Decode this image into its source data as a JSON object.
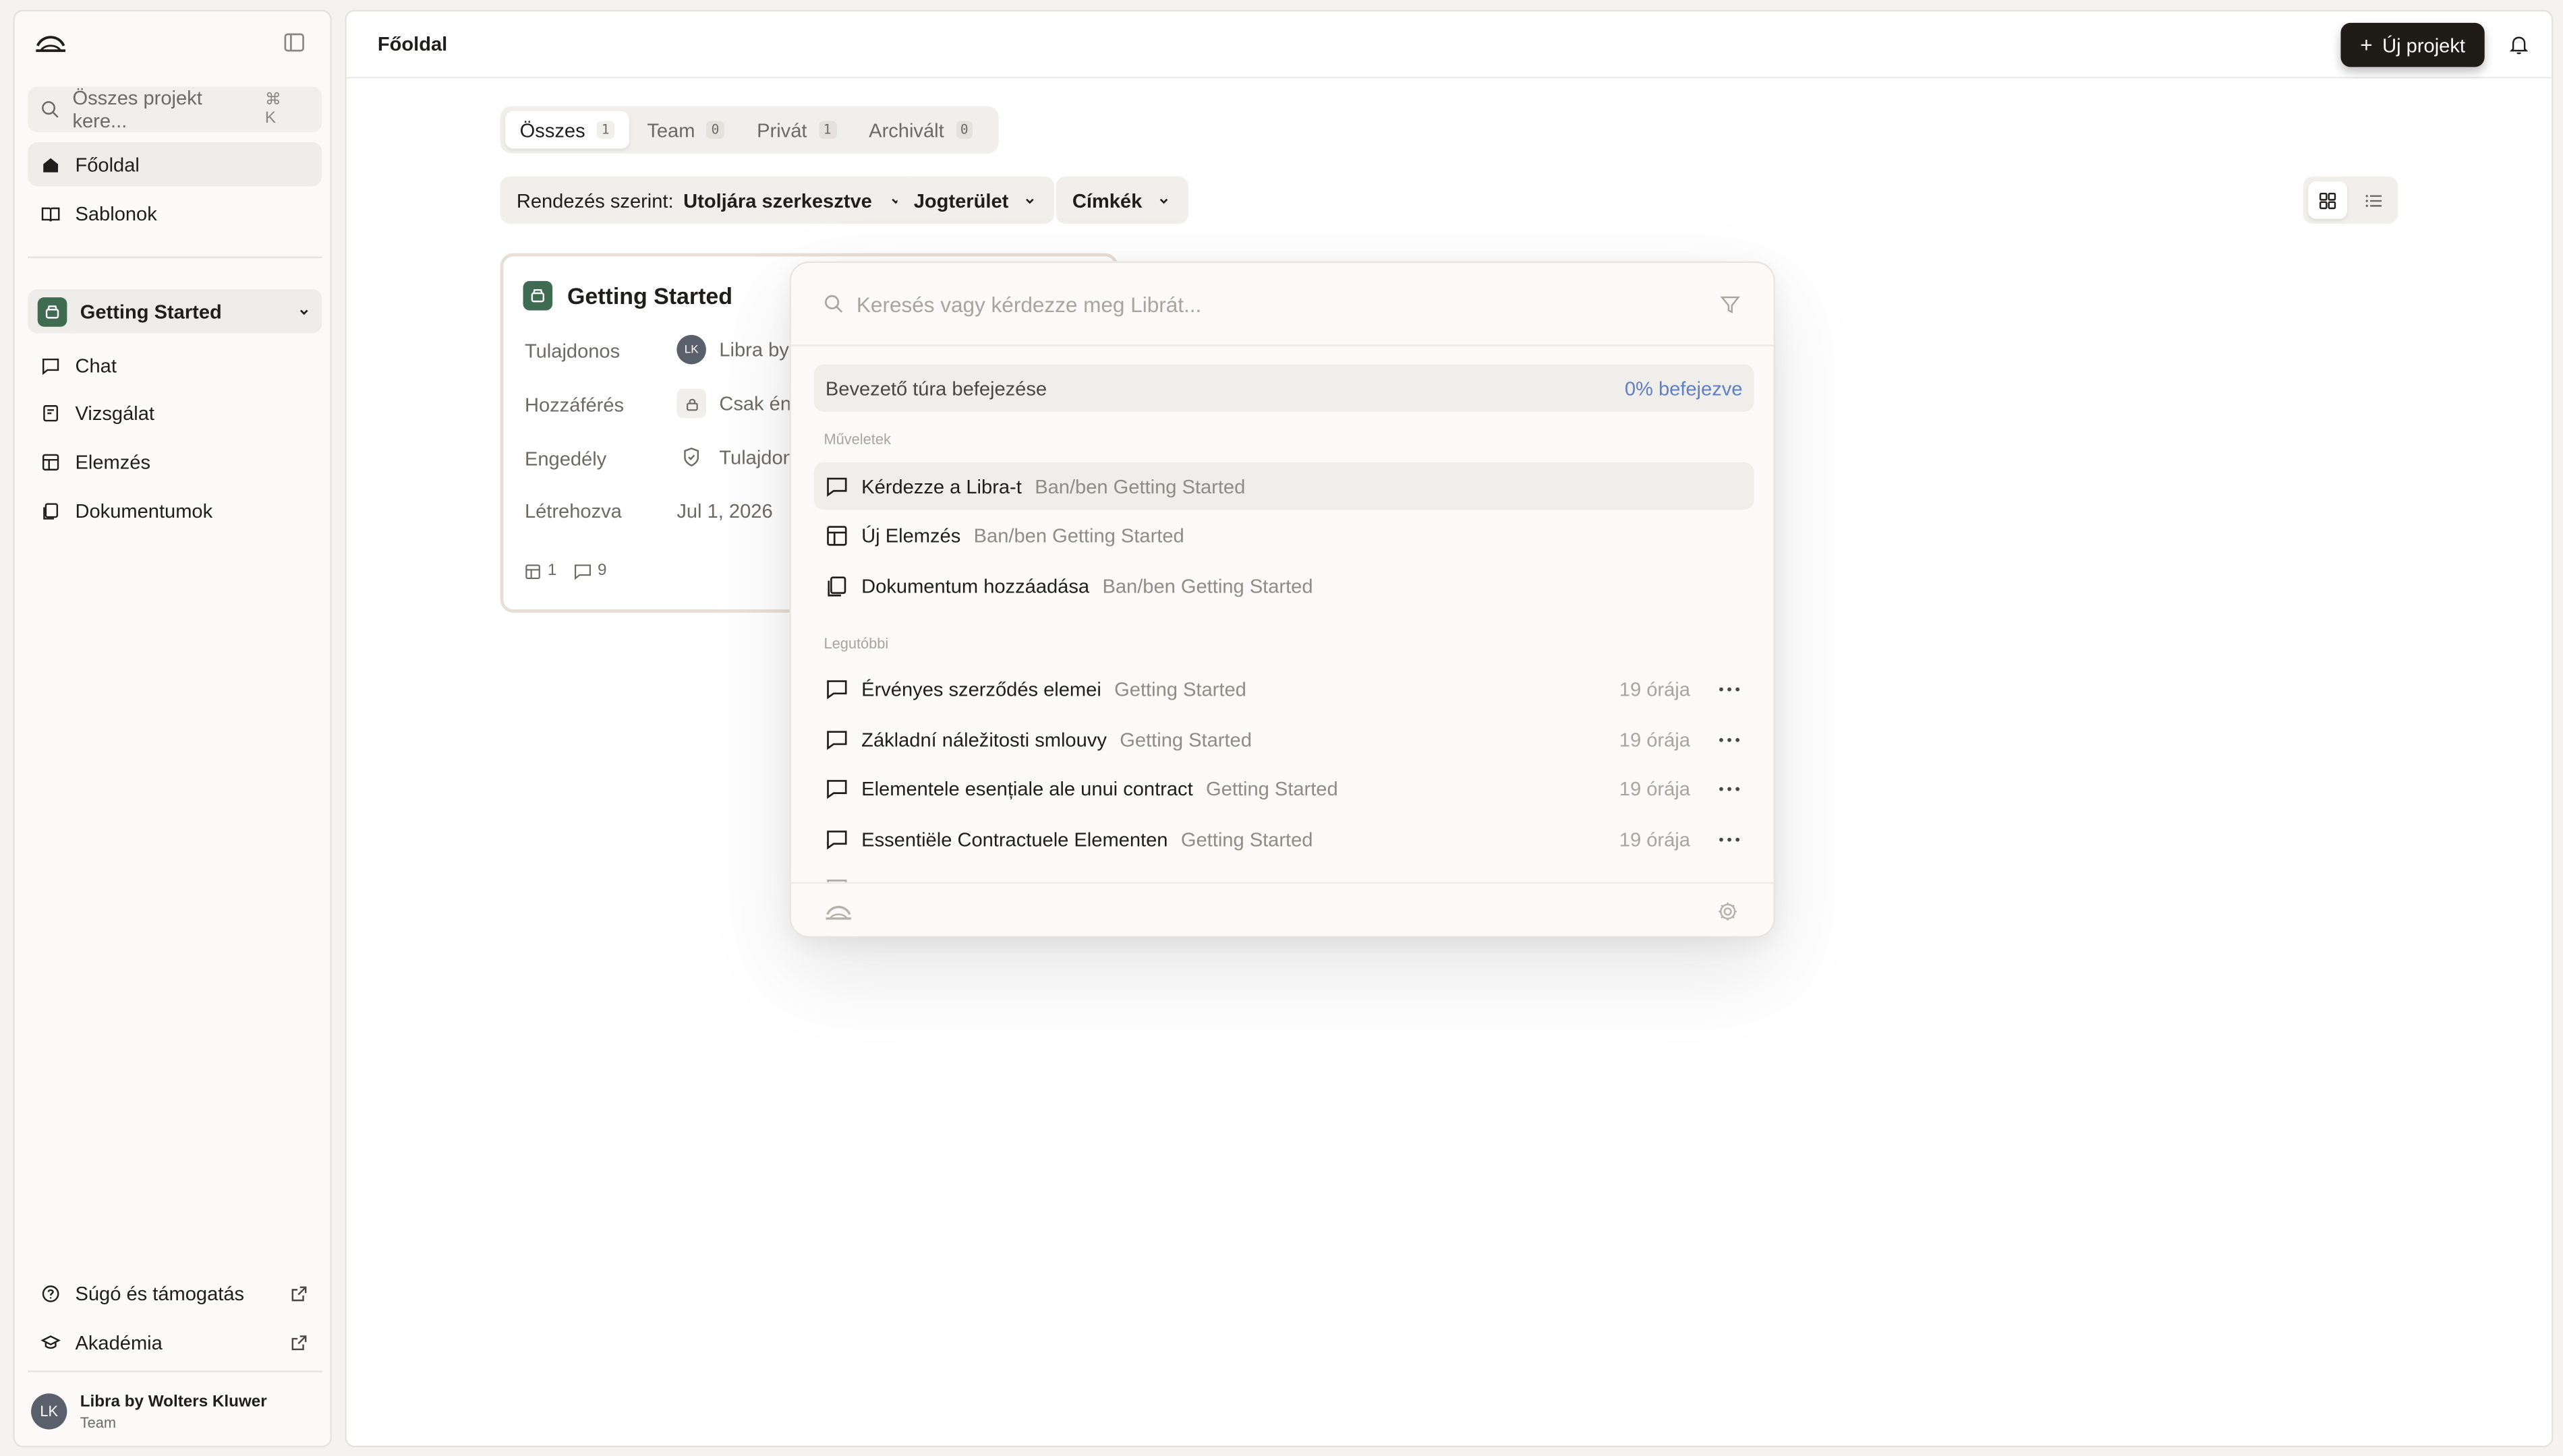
{
  "sidebar": {
    "search_placeholder": "Összes projekt kere...",
    "search_shortcut": "⌘ K",
    "nav": [
      {
        "label": "Főoldal",
        "icon": "home-icon",
        "active": true
      },
      {
        "label": "Sablonok",
        "icon": "book-icon",
        "active": false
      }
    ],
    "project": {
      "label": "Getting Started",
      "icon": "project-box-icon"
    },
    "project_nav": [
      {
        "label": "Chat",
        "icon": "chat-icon"
      },
      {
        "label": "Vizsgálat",
        "icon": "review-icon"
      },
      {
        "label": "Elemzés",
        "icon": "table-icon"
      },
      {
        "label": "Dokumentumok",
        "icon": "documents-icon"
      }
    ],
    "bottom": [
      {
        "label": "Súgó és támogatás",
        "icon": "help-icon"
      },
      {
        "label": "Akadémia",
        "icon": "academy-icon"
      }
    ],
    "user": {
      "initials": "LK",
      "name": "Libra by Wolters Kluwer",
      "team": "Team"
    }
  },
  "header": {
    "title": "Főoldal",
    "new_project_label": "Új projekt"
  },
  "tabs": [
    {
      "label": "Összes",
      "count": "1",
      "active": true
    },
    {
      "label": "Team",
      "count": "0",
      "active": false
    },
    {
      "label": "Privát",
      "count": "1",
      "active": false
    },
    {
      "label": "Archivált",
      "count": "0",
      "active": false
    }
  ],
  "filters": {
    "sort_prefix": "Rendezés szerint:",
    "sort_value": "Utoljára szerkesztve",
    "jurisdiction": "Jogterület",
    "tags": "Címkék"
  },
  "card": {
    "title": "Getting Started",
    "rows": [
      {
        "label": "Tulajdonos",
        "value": "Libra by"
      },
      {
        "label": "Hozzáférés",
        "value": "Csak én"
      },
      {
        "label": "Engedély",
        "value": "Tulajdon"
      },
      {
        "label": "Létrehozva",
        "value": "Jul 1, 2026"
      }
    ],
    "owner_initials": "LK",
    "tables_count": "1",
    "chats_count": "9"
  },
  "palette": {
    "placeholder": "Keresés vagy kérdezze meg Librát...",
    "tour_label": "Bevezető túra befejezése",
    "tour_progress": "0% befejezve",
    "actions_label": "Műveletek",
    "actions": [
      {
        "label": "Kérdezze a Libra-t",
        "context": "Ban/ben Getting Started",
        "icon": "chat-icon"
      },
      {
        "label": "Új Elemzés",
        "context": "Ban/ben Getting Started",
        "icon": "table-icon"
      },
      {
        "label": "Dokumentum hozzáadása",
        "context": "Ban/ben Getting Started",
        "icon": "documents-icon"
      }
    ],
    "recent_label": "Legutóbbi",
    "recent": [
      {
        "label": "Érvényes szerződés elemei",
        "context": "Getting Started",
        "time": "19 órája"
      },
      {
        "label": "Základní náležitosti smlouvy",
        "context": "Getting Started",
        "time": "19 órája"
      },
      {
        "label": "Elementele esențiale ale unui contract",
        "context": "Getting Started",
        "time": "19 órája"
      },
      {
        "label": "Essentiële Contractuele Elementen",
        "context": "Getting Started",
        "time": "19 órája"
      }
    ]
  },
  "colors": {
    "accent_dark": "#1f1b17",
    "project_green": "#3f6b52",
    "progress_blue": "#5f7fc4"
  }
}
